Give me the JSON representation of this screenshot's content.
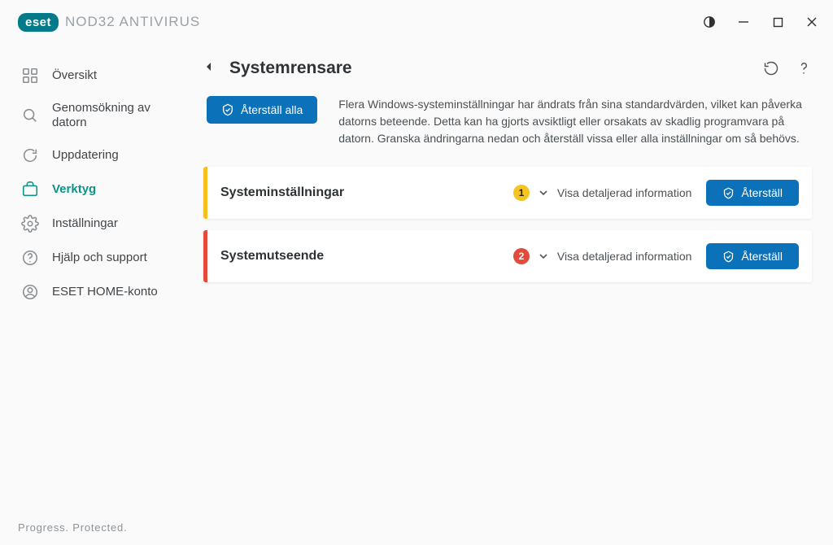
{
  "brand": {
    "badge": "eset",
    "product": "NOD32 ANTIVIRUS"
  },
  "sidebar": {
    "items": [
      {
        "label": "Översikt"
      },
      {
        "label": "Genomsökning av datorn"
      },
      {
        "label": "Uppdatering"
      },
      {
        "label": "Verktyg"
      },
      {
        "label": "Inställningar"
      },
      {
        "label": "Hjälp och support"
      },
      {
        "label": "ESET HOME-konto"
      }
    ]
  },
  "page": {
    "title": "Systemrensare",
    "reset_all_label": "Återställ alla",
    "intro": "Flera Windows-systeminställningar har ändrats från sina standardvärden, vilket kan påverka datorns beteende. Detta kan ha gjorts avsiktligt eller orsakats av skadlig programvara på datorn. Granska ändringarna nedan och återställ vissa eller alla inställningar om så behövs."
  },
  "cards": [
    {
      "title": "Systeminställningar",
      "count": "1",
      "expand_label": "Visa detaljerad information",
      "reset_label": "Återställ",
      "severity": "yellow"
    },
    {
      "title": "Systemutseende",
      "count": "2",
      "expand_label": "Visa detaljerad information",
      "reset_label": "Återställ",
      "severity": "red"
    }
  ],
  "footer": "Progress. Protected."
}
